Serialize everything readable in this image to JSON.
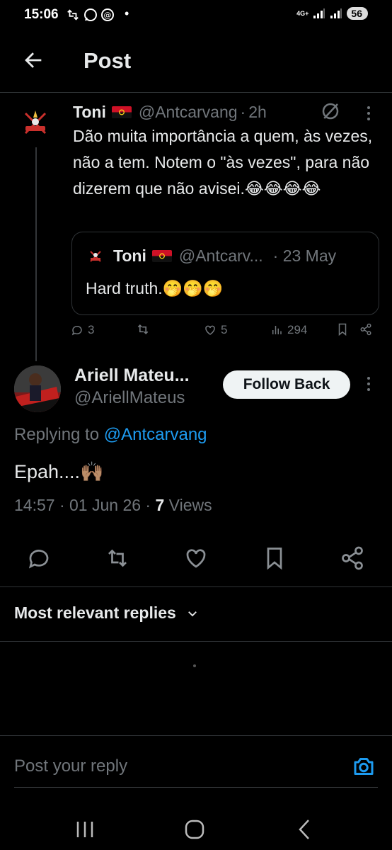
{
  "status_bar": {
    "time": "15:06",
    "dot": "•",
    "network": "4G+",
    "battery": "56"
  },
  "header": {
    "title": "Post"
  },
  "original_tweet": {
    "author_name": "Toni",
    "handle": "@Antcarvang",
    "separator": "·",
    "time": "2h",
    "text": "Dão muita importância a quem, às vezes, não a tem. Notem o \"às vezes\", para não dizerem que não avisei.😂😂😂😂",
    "quoted": {
      "author_name": "Toni",
      "handle": "@Antcarv...",
      "date": "· 23 May",
      "text": "Hard truth.🤭🤭🤭"
    },
    "stats": {
      "replies": "3",
      "reposts": "",
      "likes": "5",
      "views": "294"
    }
  },
  "reply": {
    "author_name": "Ariell Mateu...",
    "handle": "@AriellMateus",
    "follow_label": "Follow Back",
    "replying_prefix": "Replying to ",
    "replying_to": "@Antcarvang",
    "text": "Epah....🙌🏽",
    "time": "14:57 · 01 Jun 26 · ",
    "views_count": "7",
    "views_label": " Views"
  },
  "sort": {
    "label": "Most relevant replies"
  },
  "composer": {
    "placeholder": "Post your reply"
  },
  "icons": {
    "back": "arrow-left-icon",
    "grok": "grok-icon",
    "more": "more-vertical-icon",
    "reply": "reply-icon",
    "repost": "repost-icon",
    "like": "heart-icon",
    "views": "views-icon",
    "bookmark": "bookmark-icon",
    "share": "share-icon",
    "camera": "camera-icon"
  },
  "colors": {
    "background": "#000000",
    "accent": "#1d9bf0",
    "muted": "#71767b",
    "text": "#e7e9ea"
  }
}
